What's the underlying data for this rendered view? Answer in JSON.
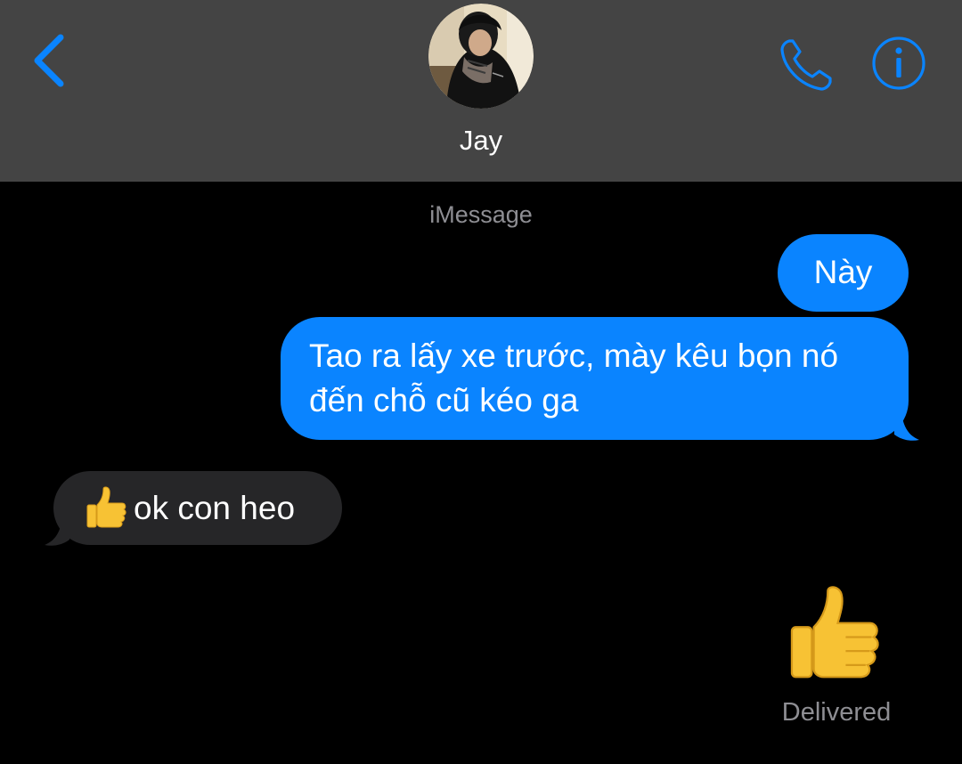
{
  "header": {
    "contact_name": "Jay",
    "accent_color": "#0a84ff",
    "back_icon": "chevron-left-icon",
    "call_icon": "phone-icon",
    "info_icon": "info-icon"
  },
  "thread": {
    "service_label": "iMessage",
    "messages": [
      {
        "direction": "outgoing",
        "text": "Này"
      },
      {
        "direction": "outgoing",
        "text": "Tao ra lấy xe trước, mày kêu bọn nó đến chỗ cũ kéo ga"
      },
      {
        "direction": "incoming",
        "emoji": "thumbs-up-icon",
        "text": "ok con heo"
      },
      {
        "direction": "outgoing",
        "emoji": "thumbs-up-icon"
      }
    ],
    "status": "Delivered"
  }
}
